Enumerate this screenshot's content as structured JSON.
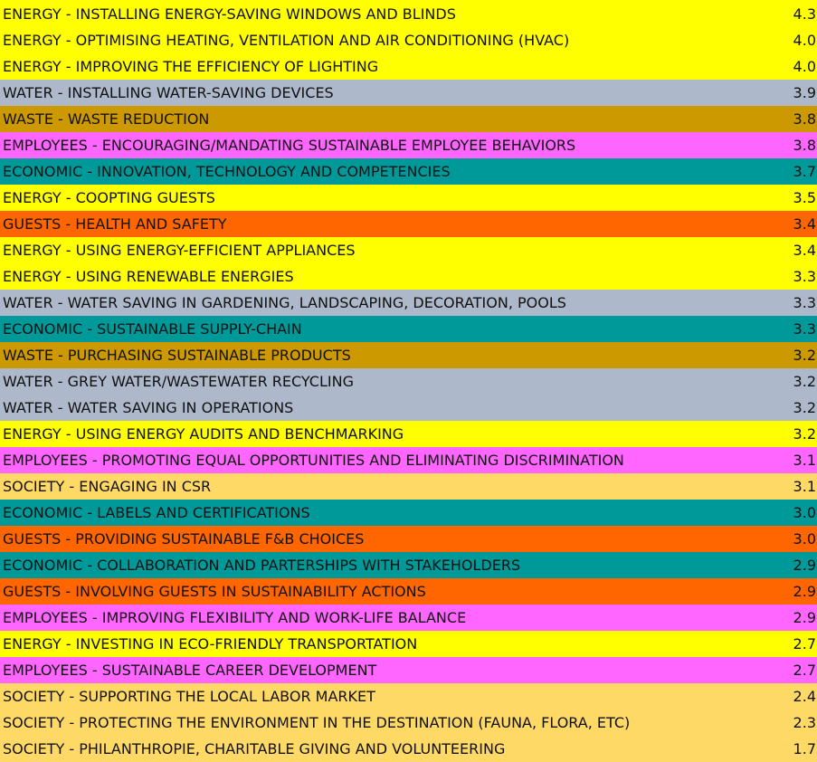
{
  "colors": {
    "ENERGY": "#ffff00",
    "WATER": "#adb9ca",
    "WASTE": "#cc9900",
    "EMPLOYEES": "#ff66ff",
    "ECONOMIC": "#009999",
    "GUESTS": "#ff6600",
    "SOCIETY": "#ffd966"
  },
  "rows": [
    {
      "label": "ENERGY - INSTALLING ENERGY-SAVING WINDOWS AND BLINDS",
      "value": "4.3",
      "category": "ENERGY"
    },
    {
      "label": "ENERGY - OPTIMISING HEATING, VENTILATION AND AIR CONDITIONING (HVAC)",
      "value": "4.0",
      "category": "ENERGY"
    },
    {
      "label": "ENERGY - IMPROVING THE EFFICIENCY OF LIGHTING",
      "value": "4.0",
      "category": "ENERGY"
    },
    {
      "label": "WATER - INSTALLING WATER-SAVING DEVICES",
      "value": "3.9",
      "category": "WATER"
    },
    {
      "label": "WASTE - WASTE REDUCTION",
      "value": "3.8",
      "category": "WASTE"
    },
    {
      "label": "EMPLOYEES - ENCOURAGING/MANDATING SUSTAINABLE EMPLOYEE BEHAVIORS",
      "value": "3.8",
      "category": "EMPLOYEES"
    },
    {
      "label": "ECONOMIC - INNOVATION, TECHNOLOGY AND COMPETENCIES",
      "value": "3.7",
      "category": "ECONOMIC"
    },
    {
      "label": "ENERGY - COOPTING GUESTS",
      "value": "3.5",
      "category": "ENERGY"
    },
    {
      "label": "GUESTS - HEALTH AND SAFETY",
      "value": "3.4",
      "category": "GUESTS"
    },
    {
      "label": "ENERGY - USING ENERGY-EFFICIENT APPLIANCES",
      "value": "3.4",
      "category": "ENERGY"
    },
    {
      "label": "ENERGY - USING RENEWABLE ENERGIES",
      "value": "3.3",
      "category": "ENERGY"
    },
    {
      "label": "WATER - WATER SAVING IN GARDENING, LANDSCAPING, DECORATION, POOLS",
      "value": "3.3",
      "category": "WATER"
    },
    {
      "label": "ECONOMIC - SUSTAINABLE SUPPLY-CHAIN",
      "value": "3.3",
      "category": "ECONOMIC"
    },
    {
      "label": "WASTE - PURCHASING SUSTAINABLE PRODUCTS",
      "value": "3.2",
      "category": "WASTE"
    },
    {
      "label": "WATER - GREY WATER/WASTEWATER RECYCLING",
      "value": "3.2",
      "category": "WATER"
    },
    {
      "label": "WATER - WATER SAVING IN OPERATIONS",
      "value": "3.2",
      "category": "WATER"
    },
    {
      "label": "ENERGY - USING ENERGY AUDITS AND BENCHMARKING",
      "value": "3.2",
      "category": "ENERGY"
    },
    {
      "label": "EMPLOYEES - PROMOTING EQUAL OPPORTUNITIES AND ELIMINATING DISCRIMINATION",
      "value": "3.1",
      "category": "EMPLOYEES"
    },
    {
      "label": "SOCIETY - ENGAGING IN CSR",
      "value": "3.1",
      "category": "SOCIETY"
    },
    {
      "label": "ECONOMIC - LABELS AND CERTIFICATIONS",
      "value": "3.0",
      "category": "ECONOMIC"
    },
    {
      "label": "GUESTS - PROVIDING SUSTAINABLE F&B CHOICES",
      "value": "3.0",
      "category": "GUESTS"
    },
    {
      "label": "ECONOMIC - COLLABORATION AND PARTERSHIPS WITH STAKEHOLDERS",
      "value": "2.9",
      "category": "ECONOMIC"
    },
    {
      "label": "GUESTS - INVOLVING GUESTS IN SUSTAINABILITY ACTIONS",
      "value": "2.9",
      "category": "GUESTS"
    },
    {
      "label": "EMPLOYEES - IMPROVING FLEXIBILITY AND WORK-LIFE BALANCE",
      "value": "2.9",
      "category": "EMPLOYEES"
    },
    {
      "label": "ENERGY - INVESTING IN ECO-FRIENDLY TRANSPORTATION",
      "value": "2.7",
      "category": "ENERGY"
    },
    {
      "label": "EMPLOYEES - SUSTAINABLE CAREER DEVELOPMENT",
      "value": "2.7",
      "category": "EMPLOYEES"
    },
    {
      "label": "SOCIETY - SUPPORTING THE LOCAL LABOR MARKET",
      "value": "2.4",
      "category": "SOCIETY"
    },
    {
      "label": "SOCIETY - PROTECTING THE ENVIRONMENT IN THE DESTINATION (FAUNA, FLORA, ETC)",
      "value": "2.3",
      "category": "SOCIETY"
    },
    {
      "label": "SOCIETY - PHILANTHROPIE, CHARITABLE GIVING AND VOLUNTEERING",
      "value": "1.7",
      "category": "SOCIETY"
    }
  ]
}
